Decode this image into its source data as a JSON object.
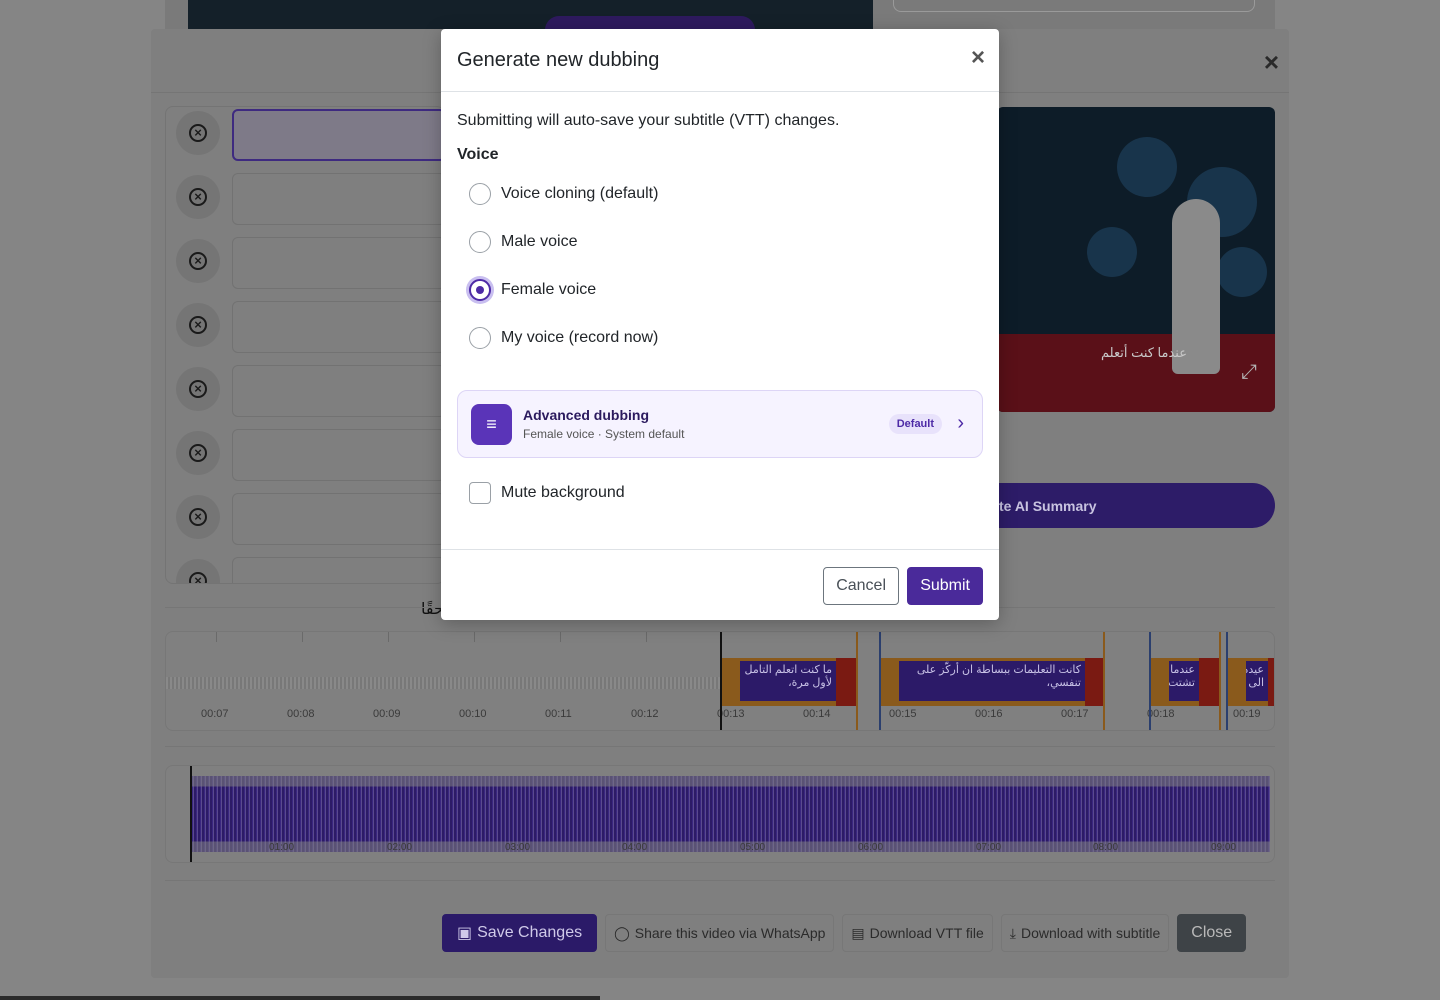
{
  "background": {
    "subtitle_snippet": "حقًا",
    "video_caption": "عندما كنت أتعلم",
    "ai_summary_label": "te AI Summary",
    "timeline_ticks": [
      "00:07",
      "00:08",
      "00:09",
      "00:10",
      "00:11",
      "00:12",
      "00:13",
      "00:14",
      "00:15",
      "00:16",
      "00:17",
      "00:18",
      "00:19"
    ],
    "segments": [
      {
        "text": "ما كنت اتعلم التامل لأول مرة،"
      },
      {
        "text": "كانت التعليمات ببساطة ان أركّز على تنفسي،"
      },
      {
        "text": "عندما تشتت"
      },
      {
        "text": "عيده الى"
      }
    ],
    "overview_ticks": [
      "01:00",
      "02:00",
      "03:00",
      "04:00",
      "05:00",
      "06:00",
      "07:00",
      "08:00",
      "09:00"
    ],
    "footer": {
      "save": "Save Changes",
      "share": "Share this video via WhatsApp",
      "download_vtt": "Download VTT file",
      "download_sub": "Download with subtitle",
      "close": "Close"
    }
  },
  "modal": {
    "title": "Generate new dubbing",
    "notice": "Submitting will auto-save your subtitle (VTT) changes.",
    "voice_label": "Voice",
    "voice_options": [
      {
        "label": "Voice cloning (default)",
        "checked": false
      },
      {
        "label": "Male voice",
        "checked": false
      },
      {
        "label": "Female voice",
        "checked": true
      },
      {
        "label": "My voice (record now)",
        "checked": false
      }
    ],
    "advanced": {
      "title": "Advanced dubbing",
      "subtitle": "Female voice · System default",
      "badge": "Default"
    },
    "mute_label": "Mute background",
    "mute_checked": false,
    "cancel": "Cancel",
    "submit": "Submit"
  },
  "colors": {
    "accent": "#4a2a9a",
    "overlay": "#858585"
  }
}
